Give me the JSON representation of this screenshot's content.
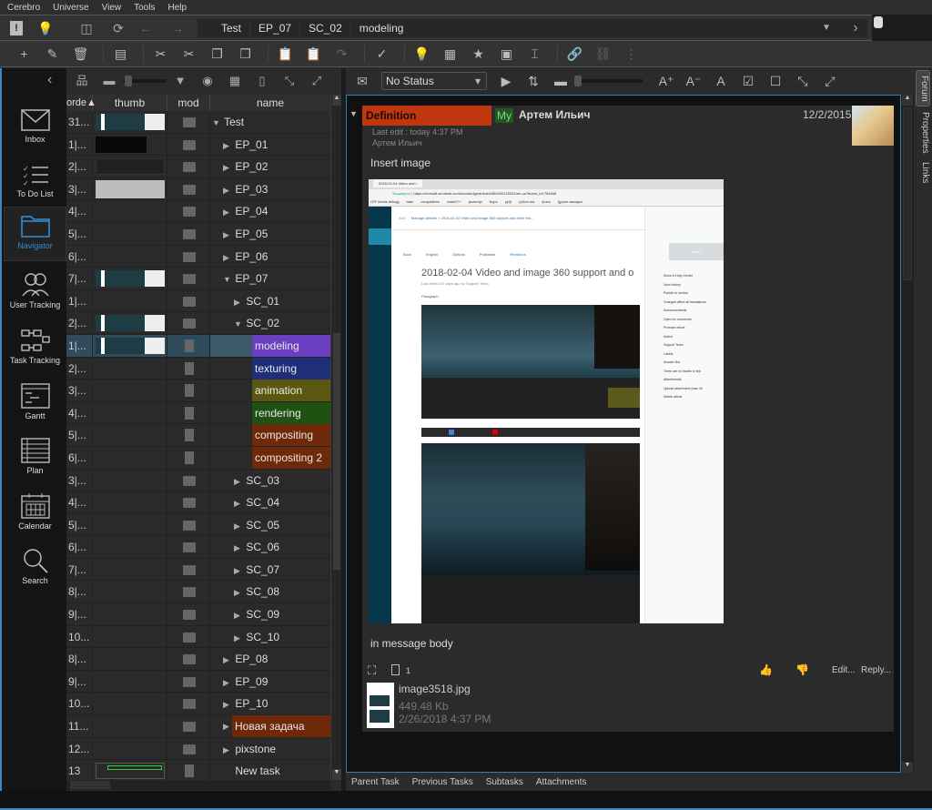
{
  "menu": [
    "Cerebro",
    "Universe",
    "View",
    "Tools",
    "Help"
  ],
  "breadcrumb": [
    "Test",
    "EP_07",
    "SC_02",
    "modeling"
  ],
  "sidebar": [
    {
      "label": "Inbox",
      "icon": "inbox-icon"
    },
    {
      "label": "To Do List",
      "icon": "todo-list-icon"
    },
    {
      "label": "Navigator",
      "icon": "folder-icon",
      "active": true
    },
    {
      "label": "User Tracking",
      "icon": "users-icon"
    },
    {
      "label": "Task Tracking",
      "icon": "task-tracking-icon"
    },
    {
      "label": "Gantt",
      "icon": "gantt-icon"
    },
    {
      "label": "Plan",
      "icon": "plan-icon"
    },
    {
      "label": "Calendar",
      "icon": "calendar-icon"
    },
    {
      "label": "Search",
      "icon": "search-icon"
    }
  ],
  "tree": {
    "columns": [
      "orde▲",
      "thumb",
      "mod",
      "name"
    ],
    "rows": [
      {
        "order": "31...",
        "thumb": "w",
        "type": "folder",
        "name": "Test",
        "level": 0,
        "exp": "open"
      },
      {
        "order": "1|...",
        "thumb": "dark",
        "type": "folder",
        "name": "EP_01",
        "level": 1,
        "exp": "closed"
      },
      {
        "order": "2|...",
        "thumb": "code",
        "type": "folder",
        "name": "EP_02",
        "level": 1,
        "exp": "closed"
      },
      {
        "order": "3|...",
        "thumb": "gray",
        "type": "folder",
        "name": "EP_03",
        "level": 1,
        "exp": "closed"
      },
      {
        "order": "4|...",
        "thumb": "",
        "type": "folder",
        "name": "EP_04",
        "level": 1,
        "exp": "closed"
      },
      {
        "order": "5|...",
        "thumb": "",
        "type": "folder",
        "name": "EP_05",
        "level": 1,
        "exp": "closed"
      },
      {
        "order": "6|...",
        "thumb": "",
        "type": "folder",
        "name": "EP_06",
        "level": 1,
        "exp": "closed"
      },
      {
        "order": "7|...",
        "thumb": "w",
        "type": "folder",
        "name": "EP_07",
        "level": 1,
        "exp": "open"
      },
      {
        "order": "1|...",
        "thumb": "",
        "type": "folder",
        "name": "SC_01",
        "level": 2,
        "exp": "closed"
      },
      {
        "order": "2|...",
        "thumb": "w",
        "type": "folder",
        "name": "SC_02",
        "level": 2,
        "exp": "open"
      },
      {
        "order": "1|...",
        "thumb": "w",
        "type": "doc",
        "name": "modeling",
        "level": 3,
        "color": "#6a3fc0",
        "selected": true
      },
      {
        "order": "2|...",
        "thumb": "",
        "type": "doc",
        "name": "texturing",
        "level": 3,
        "color": "#1e2e78"
      },
      {
        "order": "3|...",
        "thumb": "",
        "type": "doc",
        "name": "animation",
        "level": 3,
        "color": "#5a5810"
      },
      {
        "order": "4|...",
        "thumb": "",
        "type": "doc",
        "name": "rendering",
        "level": 3,
        "color": "#1f5212"
      },
      {
        "order": "5|...",
        "thumb": "",
        "type": "doc",
        "name": "compositing",
        "level": 3,
        "color": "#6e2a08"
      },
      {
        "order": "6|...",
        "thumb": "",
        "type": "doc",
        "name": "compositing 2",
        "level": 3,
        "color": "#6e2a08"
      },
      {
        "order": "3|...",
        "thumb": "",
        "type": "folder",
        "name": "SC_03",
        "level": 2,
        "exp": "closed"
      },
      {
        "order": "4|...",
        "thumb": "",
        "type": "folder",
        "name": "SC_04",
        "level": 2,
        "exp": "closed"
      },
      {
        "order": "5|...",
        "thumb": "",
        "type": "folder",
        "name": "SC_05",
        "level": 2,
        "exp": "closed"
      },
      {
        "order": "6|...",
        "thumb": "",
        "type": "folder",
        "name": "SC_06",
        "level": 2,
        "exp": "closed"
      },
      {
        "order": "7|...",
        "thumb": "",
        "type": "folder",
        "name": "SC_07",
        "level": 2,
        "exp": "closed"
      },
      {
        "order": "8|...",
        "thumb": "",
        "type": "folder",
        "name": "SC_08",
        "level": 2,
        "exp": "closed"
      },
      {
        "order": "9|...",
        "thumb": "",
        "type": "folder",
        "name": "SC_09",
        "level": 2,
        "exp": "closed"
      },
      {
        "order": "10...",
        "thumb": "",
        "type": "folder",
        "name": "SC_10",
        "level": 2,
        "exp": "closed"
      },
      {
        "order": "8|...",
        "thumb": "",
        "type": "folder",
        "name": "EP_08",
        "level": 1,
        "exp": "closed"
      },
      {
        "order": "9|...",
        "thumb": "",
        "type": "folder",
        "name": "EP_09",
        "level": 1,
        "exp": "closed"
      },
      {
        "order": "10...",
        "thumb": "",
        "type": "folder",
        "name": "EP_10",
        "level": 1,
        "exp": "closed"
      },
      {
        "order": "11...",
        "thumb": "",
        "type": "folder",
        "name": "Новая задача",
        "level": 1,
        "exp": "closed",
        "color": "#6e2a08"
      },
      {
        "order": "12...",
        "thumb": "",
        "type": "folder",
        "name": "pixstone",
        "level": 1,
        "exp": "closed"
      },
      {
        "order": "13",
        "thumb": "green",
        "type": "doc",
        "name": "New task",
        "level": 1,
        "exp": "none"
      }
    ]
  },
  "status_select": "No Status",
  "forum": {
    "message": {
      "type_label": "Definition",
      "type_color": "#c0360f",
      "my_badge": "My",
      "author": "Артем Ильич",
      "date": "12/2/2015",
      "last_edit": "Last edit : today 4:37 PM",
      "editor": "Артем Ильич",
      "text_before": "Insert image",
      "text_after": "in message body",
      "attach_count": "1",
      "edit_label": "Edit...",
      "reply_label": "Reply...",
      "attachment": {
        "name": "image3518.jpg",
        "size": "449.48 Kb",
        "date": "2/26/2018 4:37 PM"
      }
    },
    "embedded": {
      "tab_title": "2018-02-04 Video and i",
      "url": "https://cinesoft.zendesk.com/knowledge/articles/360000120043/en-us?brand_id=764406",
      "secure_label": "Защищено",
      "bookmarks": [
        "CEF remote debugg",
        "bash",
        "crossplatform",
        "insideC++",
        "javascript",
        "lingvo",
        "pyQt",
        "python.doc",
        "qt.doc",
        "Другие закладки"
      ],
      "add_label": "Add",
      "breadcrumb": "Manage articles  >  2018-02-04 Video and image 360 support and other fea...",
      "help_center": "Help Center",
      "back": "Back",
      "lang": "English",
      "options": "Options",
      "published": "Published",
      "revisions": "Revisions",
      "save": "Save",
      "article_title": "2018-02-04 Video and image 360 support and o",
      "last_edited": "Last edited 22 days ago by Support Team",
      "paragraph": "Paragraph",
      "side": [
        "Show in Help Center",
        "View history",
        "Publish in section",
        "Changes affect all translations",
        "Announcements",
        "Open for comments",
        "Promote article",
        "Author",
        "Support Team",
        "Labels",
        "Answer Bot",
        "There are no tickets to link",
        "Attachments",
        "Upload attachment (max 20",
        "Delete article"
      ]
    }
  },
  "side_tabs": [
    "Forum",
    "Properties",
    "Links"
  ],
  "bottom_tabs": [
    "Parent Task",
    "Previous Tasks",
    "Subtasks",
    "Attachments"
  ]
}
